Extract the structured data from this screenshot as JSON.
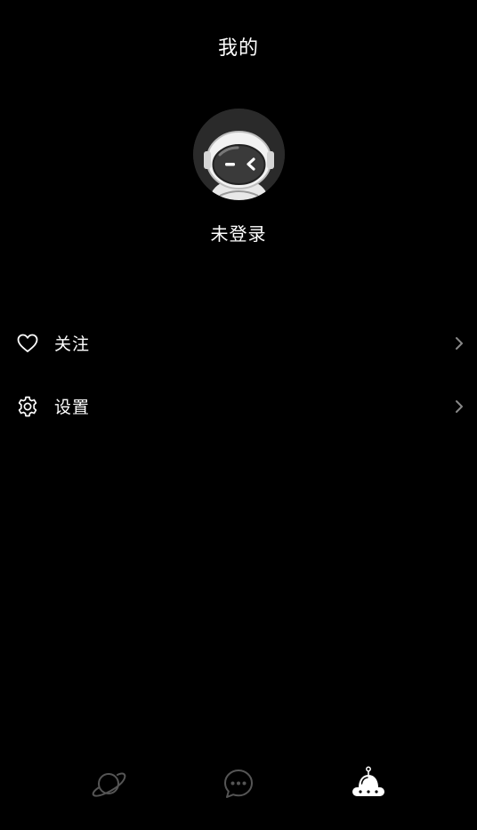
{
  "header": {
    "title": "我的"
  },
  "profile": {
    "status": "未登录",
    "avatar_icon": "astronaut-avatar"
  },
  "menu": {
    "items": [
      {
        "label": "关注",
        "icon": "heart-icon"
      },
      {
        "label": "设置",
        "icon": "gear-icon"
      }
    ]
  },
  "tabbar": {
    "tabs": [
      {
        "icon": "planet-icon",
        "active": false
      },
      {
        "icon": "chat-bubble-icon",
        "active": false
      },
      {
        "icon": "ufo-robot-icon",
        "active": true
      }
    ]
  },
  "colors": {
    "background": "#000000",
    "active": "#ffffff",
    "inactive": "#555555"
  }
}
